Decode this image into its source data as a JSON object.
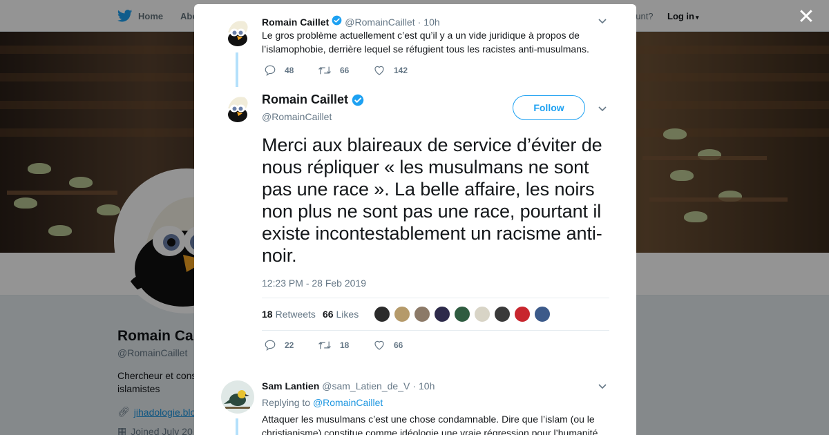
{
  "nav": {
    "home_label": "Home",
    "about_label": "Abo",
    "account_prompt": "ccount?",
    "login_label": "Log in"
  },
  "profile": {
    "name": "Romain Ca",
    "handle": "@RomainCaillet",
    "bio": "Chercheur et cons islamistes",
    "link": "jihadologie.blo",
    "joined": "Joined July 20"
  },
  "modal": {
    "close_label": "✕",
    "parent_tweet": {
      "name": "Romain Caillet",
      "handle": "@RomainCaillet",
      "time": "10h",
      "text": "Le gros problème actuellement c’est qu’il y a un vide juridique à propos de l’islamophobie, derrière lequel se réfugient tous les racistes anti-musulmans.",
      "replies": "48",
      "retweets": "66",
      "likes": "142"
    },
    "main_tweet": {
      "name": "Romain Caillet",
      "handle": "@RomainCaillet",
      "follow_label": "Follow",
      "text": "Merci aux blaireaux de service d’éviter de nous répliquer « les musulmans ne sont pas une race ». La belle affaire, les noirs non plus ne sont pas une race, pourtant il existe incontestablement un racisme anti-noir.",
      "timestamp": "12:23 PM - 28 Feb 2019",
      "retweet_count": "18",
      "retweet_label": "Retweets",
      "like_count": "66",
      "like_label": "Likes",
      "liker_colors": [
        "#2b2b2b",
        "#b59a6a",
        "#8c7a68",
        "#2d2a4a",
        "#2f5c40",
        "#d8d4c6",
        "#3a3a3a",
        "#c8262e",
        "#3c5a8a"
      ],
      "replies": "22",
      "retweets": "18",
      "likes": "66"
    },
    "reply_tweet": {
      "name": "Sam Lantien",
      "handle": "@sam_Latien_de_V",
      "time": "10h",
      "replying_label": "Replying to",
      "replying_to": "@RomainCaillet",
      "text": "Attaquer les musulmans c’est une chose condamnable. Dire que l’islam (ou le christianisme) constitue comme idéologie une vraie régression pour l’humanité"
    }
  },
  "colors": {
    "brand": "#1da1f2",
    "link": "#1b95e0",
    "muted": "#657786",
    "thread_line": "#b4e0fb"
  }
}
